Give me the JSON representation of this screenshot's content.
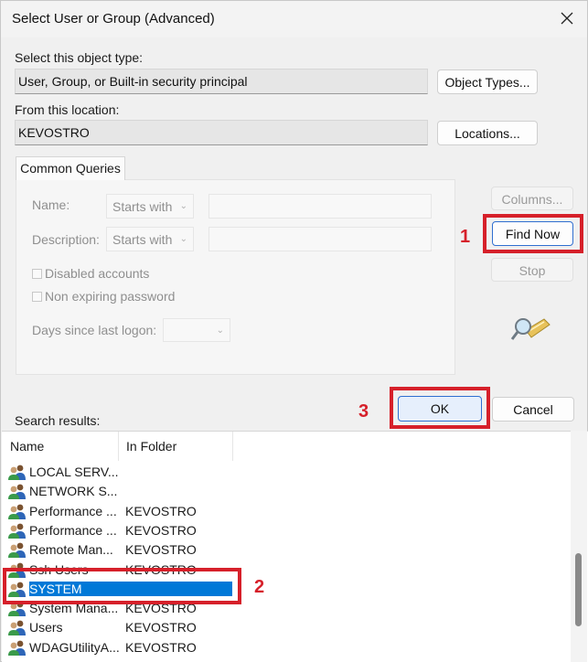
{
  "window": {
    "title": "Select User or Group (Advanced)"
  },
  "object_type": {
    "label": "Select this object type:",
    "value": "User, Group, or Built-in security principal",
    "button": "Object Types..."
  },
  "location": {
    "label": "From this location:",
    "value": "KEVOSTRO",
    "button": "Locations..."
  },
  "common_queries": {
    "tab": "Common Queries",
    "name_label": "Name:",
    "name_mode": "Starts with",
    "description_label": "Description:",
    "description_mode": "Starts with",
    "disabled_accounts": "Disabled accounts",
    "non_expiring_password": "Non expiring password",
    "days_since_logon_label": "Days since last logon:"
  },
  "side_buttons": {
    "columns": "Columns...",
    "find_now": "Find Now",
    "stop": "Stop"
  },
  "dialog_buttons": {
    "ok": "OK",
    "cancel": "Cancel"
  },
  "annotations": {
    "step1": "1",
    "step2": "2",
    "step3": "3"
  },
  "results": {
    "label": "Search results:",
    "columns": [
      "Name",
      "In Folder"
    ],
    "rows": [
      {
        "name": "LOCAL SERV...",
        "folder": ""
      },
      {
        "name": "NETWORK S...",
        "folder": ""
      },
      {
        "name": "Performance ...",
        "folder": "KEVOSTRO"
      },
      {
        "name": "Performance ...",
        "folder": "KEVOSTRO"
      },
      {
        "name": "Remote Man...",
        "folder": "KEVOSTRO"
      },
      {
        "name": "Ssh Users",
        "folder": "KEVOSTRO"
      },
      {
        "name": "SYSTEM",
        "folder": ""
      },
      {
        "name": "System Mana...",
        "folder": "KEVOSTRO"
      },
      {
        "name": "Users",
        "folder": "KEVOSTRO"
      },
      {
        "name": "WDAGUtilityA...",
        "folder": "KEVOSTRO"
      }
    ],
    "selected_index": 6
  },
  "colors": {
    "annotation_red": "#d6202a",
    "selection_blue": "#0078d7",
    "focus_blue": "#2f6fd0"
  }
}
